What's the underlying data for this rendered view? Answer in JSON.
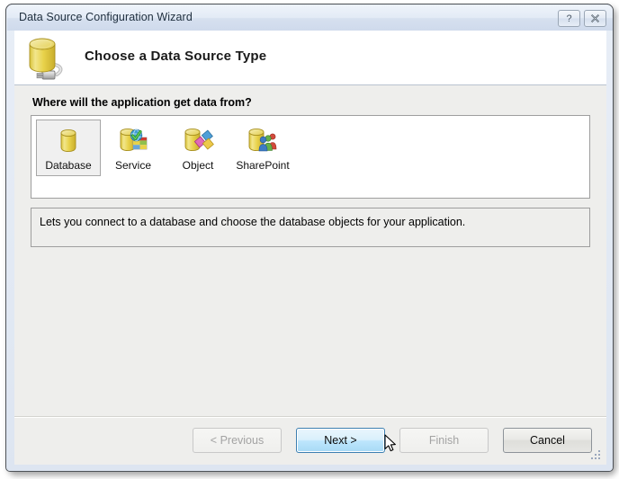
{
  "window": {
    "title": "Data Source Configuration Wizard",
    "help_button": "?",
    "close_button": "✕"
  },
  "banner": {
    "heading": "Choose a Data Source Type",
    "icon": "database-plug-icon"
  },
  "main": {
    "question": "Where will the application get data from?",
    "choices": [
      {
        "label": "Database",
        "icon": "database-icon",
        "selected": true
      },
      {
        "label": "Service",
        "icon": "service-icon",
        "selected": false
      },
      {
        "label": "Object",
        "icon": "object-icon",
        "selected": false
      },
      {
        "label": "SharePoint",
        "icon": "sharepoint-icon",
        "selected": false
      }
    ],
    "description": "Lets you connect to a database and choose the database objects for your application."
  },
  "footer": {
    "buttons": [
      {
        "label": "< Previous",
        "state": "disabled"
      },
      {
        "label": "Next >",
        "state": "default"
      },
      {
        "label": "Finish",
        "state": "disabled"
      },
      {
        "label": "Cancel",
        "state": "enabled"
      }
    ]
  },
  "colors": {
    "titlebar_top": "#eef3fa",
    "titlebar_bottom": "#cfdaec",
    "frame": "#dfe6f2",
    "body": "#eeeeec",
    "panel": "#ffffff",
    "default_button_border": "#3c7fb1",
    "default_button_fill": "#bee6fd",
    "selection_fill": "#f0f0f0",
    "cylinder_yellow": "#e8d24a"
  }
}
